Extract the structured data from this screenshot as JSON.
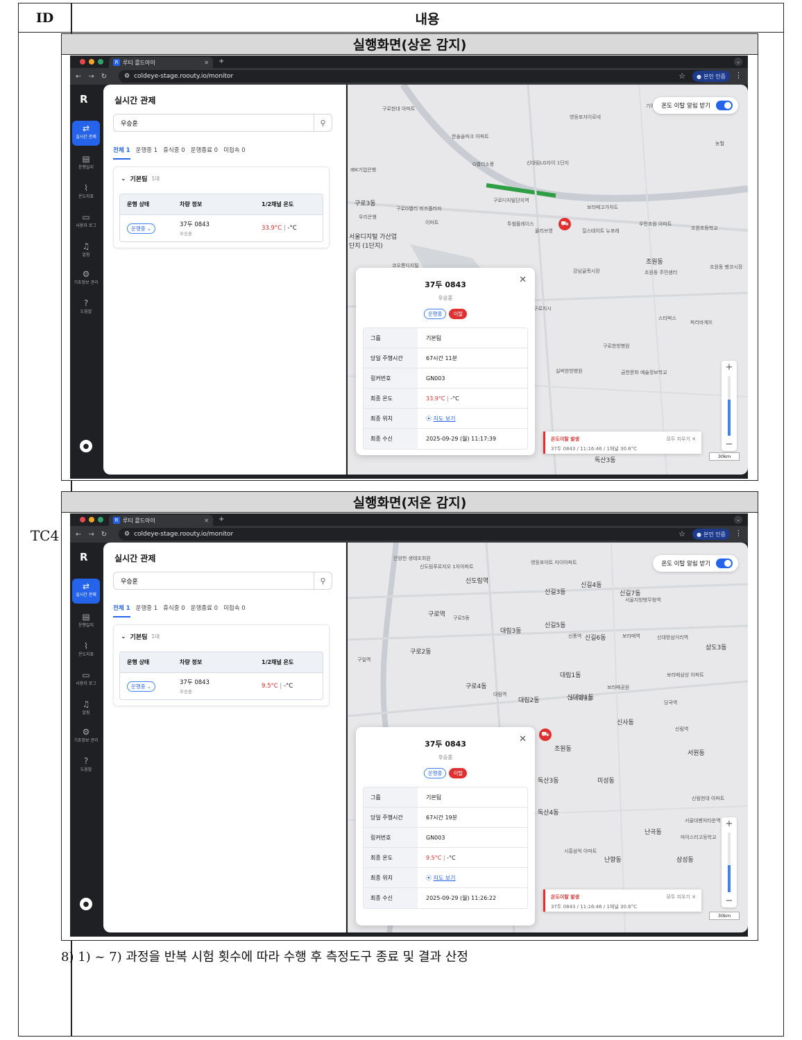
{
  "header": {
    "id_label": "ID",
    "content_label": "내용"
  },
  "test_case": "TC4",
  "note": "8) 1) ~ 7) 과정을 반복 시험 횟수에 따라 수행 후 측정도구 종료 및 결과 산정",
  "panels": [
    {
      "title": "실행화면(상온 감지)",
      "browser": {
        "tab_title": "루티 콜드아이",
        "url": "coldeye-stage.roouty.io/monitor",
        "auth_button": "본인 인증"
      },
      "nav": [
        "실시간 관제",
        "운행일지",
        "온도지표",
        "사용자 로그",
        "알림",
        "기초정보 관리",
        "도움말"
      ],
      "page_title": "실시간 관제",
      "search_value": "우승훈",
      "filters": [
        "전체 1",
        "운행중 1",
        "휴식중 0",
        "운행종료 0",
        "미접속 0"
      ],
      "group": {
        "name": "기본팀",
        "count": "1대"
      },
      "table_headers": [
        "운행 상태",
        "차량 정보",
        "1/2채널 온도"
      ],
      "row": {
        "status": "운행중",
        "plate": "37두 0843",
        "driver": "우승훈",
        "temp1": "33.9°C",
        "temp2": "-°C"
      },
      "alarm_toggle": "온도 이탈 알림 받기",
      "popup": {
        "plate": "37두 0843",
        "driver": "우승훈",
        "badge_status": "운행중",
        "badge_alert": "이탈",
        "rows": [
          {
            "k": "그룹",
            "v": "기본팀"
          },
          {
            "k": "당일 주행시간",
            "v": "67시간 11분"
          },
          {
            "k": "링커번호",
            "v": "GN003"
          },
          {
            "k": "최종 온도",
            "v": "33.9°C",
            "v2": "-°C"
          },
          {
            "k": "최종 위치",
            "v": "지도 보기"
          },
          {
            "k": "최종 수신",
            "v": "2025-09-29 (월) 11:17:39"
          }
        ]
      },
      "toast": {
        "title": "온도이탈 발생",
        "detail": "37두 0843 / 11:16:46 / 1채널 30.6°C",
        "clear": "모두 지우기 ✕"
      },
      "scale": "30km",
      "map_labels": [
        "구로현대 아파트",
        "영등포자이르네",
        "한솔솔파크 아파트",
        "신대림LG자이 1단지",
        "G밸리소풍",
        "IBK기업은행",
        "구로3동",
        "우리은행",
        "이마트",
        "구로디지털단지역",
        "보라매고가차도",
        "우민조원 아파트",
        "조원초등학교",
        "투썸플레이스",
        "올리브영",
        "힐스테이트 뉴포레",
        "조원동",
        "강남골목시장",
        "구로지시",
        "스타벅스",
        "파리바게뜨",
        "구로한방병원",
        "실버한방병원",
        "금천문화 예술정보학교",
        "기아",
        "농협",
        "구로G밸리 비즈플라자",
        "서울디지털 가산업단지 (1단지)",
        "코오롱디지털",
        "독산3동",
        "조원동 주민센터",
        "조원동 펜코시장"
      ]
    },
    {
      "title": "실행화면(저온 감지)",
      "browser": {
        "tab_title": "루티 콜드아이",
        "url": "coldeye-stage.roouty.io/monitor",
        "auth_button": "본인 인증"
      },
      "nav": [
        "실시간 관제",
        "운행일지",
        "온도지표",
        "사용자 로그",
        "알림",
        "기초정보 관리",
        "도움말"
      ],
      "page_title": "실시간 관제",
      "search_value": "우승훈",
      "filters": [
        "전체 1",
        "운행중 1",
        "휴식중 0",
        "운행종료 0",
        "미접속 0"
      ],
      "group": {
        "name": "기본팀",
        "count": "1대"
      },
      "table_headers": [
        "운행 상태",
        "차량 정보",
        "1/2채널 온도"
      ],
      "row": {
        "status": "운행중",
        "plate": "37두 0843",
        "driver": "우승훈",
        "temp1": "9.5°C",
        "temp2": "-°C"
      },
      "alarm_toggle": "온도 이탈 알림 받기",
      "popup": {
        "plate": "37두 0843",
        "driver": "우승훈",
        "badge_status": "운행중",
        "badge_alert": "이탈",
        "rows": [
          {
            "k": "그룹",
            "v": "기본팀"
          },
          {
            "k": "당일 주행시간",
            "v": "67시간 19분"
          },
          {
            "k": "링커번호",
            "v": "GN003"
          },
          {
            "k": "최종 온도",
            "v": "9.5°C",
            "v2": "-°C"
          },
          {
            "k": "최종 위치",
            "v": "지도 보기"
          },
          {
            "k": "최종 수신",
            "v": "2025-09-29 (월) 11:26:22"
          }
        ]
      },
      "toast": {
        "title": "온도이탈 발생",
        "detail": "37두 0843 / 11:16:46 / 1채널 30.6°C",
        "clear": "모두 지우기 ✕"
      },
      "scale": "30km",
      "map_labels": [
        "안양천 생태조회원",
        "신도림푸르지오 1차아파트",
        "영등포아트 자이아파트",
        "신도림역",
        "구로역",
        "구로5동",
        "신길3동",
        "신길4동",
        "신길7동",
        "서울지방병무청역",
        "신길5동",
        "신풍역",
        "신길6동",
        "보라매역",
        "신대방삼거리역",
        "상도3동",
        "대림3동",
        "구로2동",
        "구일역",
        "구로4동",
        "대림역",
        "대림2동",
        "대림1동",
        "보라매공원",
        "신대방1동",
        "당곡역",
        "신사동",
        "신림역",
        "서원동",
        "조원동",
        "독산3동",
        "미성동",
        "독산4동",
        "난곡동",
        "시흥삼익 아파트",
        "난향동",
        "삼성동",
        "서울대벤처타운역",
        "신림현대 아파트",
        "보라매병원",
        "보라매삼성 아파트",
        "마이스터고등학교"
      ]
    }
  ],
  "colors": {
    "accent": "#2563eb",
    "alert": "#e03131",
    "browser_dark": "#1f2023"
  },
  "icons": [
    "search-icon",
    "close-icon",
    "chevron-down-icon",
    "pin-icon",
    "star-icon",
    "menu-icon",
    "monitor-icon",
    "book-icon",
    "chart-icon",
    "laptop-icon",
    "bell-icon",
    "gear-icon",
    "help-icon",
    "user-icon"
  ]
}
